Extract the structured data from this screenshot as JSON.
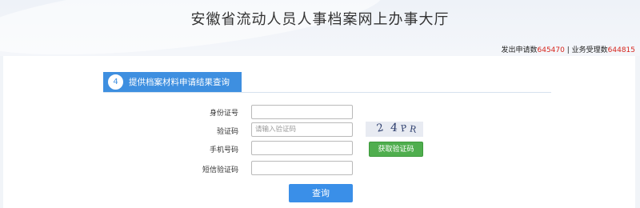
{
  "header": {
    "title": "安徽省流动人员人事档案网上办事大厅",
    "stats": {
      "apply_label": "发出申请数",
      "apply_count": "645470",
      "separator": " | ",
      "accepted_label": "业务受理数",
      "accepted_count": "644815"
    }
  },
  "section": {
    "step": "4",
    "title": "提供档案材料申请结果查询"
  },
  "form": {
    "id_label": "身份证号",
    "id_value": "",
    "captcha_label": "验证码",
    "captcha_placeholder": "请输入验证码",
    "captcha_image_text": [
      "2",
      "4",
      "P",
      "R"
    ],
    "phone_label": "手机号码",
    "phone_value": "",
    "sms_label": "短信验证码",
    "sms_value": "",
    "get_code_button": "获取验证码",
    "submit_button": "查询"
  },
  "colors": {
    "accent": "#3e8fe0",
    "count_red": "#d7261e",
    "green_button": "#4fae4e"
  }
}
